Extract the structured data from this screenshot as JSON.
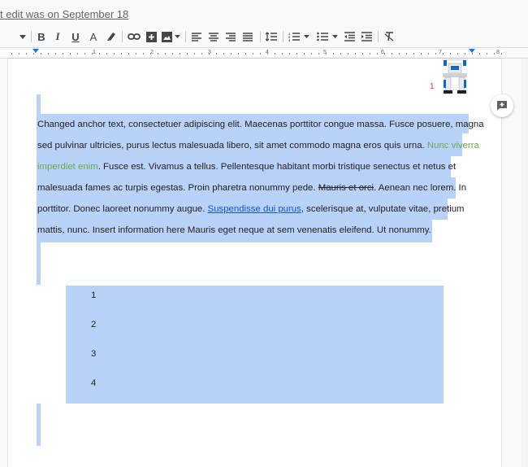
{
  "header": {
    "last_edit": "t edit was on September 18"
  },
  "toolbar": {
    "bold": "B",
    "italic": "I",
    "underline": "U",
    "text_color": "A"
  },
  "ruler": {
    "numbers": [
      "1",
      "2",
      "3",
      "4",
      "5",
      "6",
      "7",
      "8"
    ]
  },
  "document": {
    "lines": [
      [
        {
          "text": "Changed anchor text, consectetuer adipiscing elit. Maecenas porttitor congue massa. Fusce posuere, magna",
          "style": "normal"
        }
      ],
      [
        {
          "text": "sed pulvinar ultricies, purus lectus malesuada libero, sit amet commodo magna eros quis urna. ",
          "style": "normal"
        },
        {
          "text": "Nunc viverra",
          "style": "green"
        }
      ],
      [
        {
          "text": "imperdiet enim",
          "style": "green"
        },
        {
          "text": ". Fusce est. Vivamus a tellus. Pellentesque habitant morbi tristique senectus et netus et",
          "style": "normal"
        }
      ],
      [
        {
          "text": "malesuada fames ac turpis egestas. Proin pharetra nonummy pede. ",
          "style": "normal"
        },
        {
          "text": "Mauris et orci",
          "style": "strike"
        },
        {
          "text": ". Aenean nec lorem. In",
          "style": "normal"
        }
      ],
      [
        {
          "text": "porttitor. Donec laoreet nonummy augue. ",
          "style": "normal"
        },
        {
          "text": "Suspendisse dui purus",
          "style": "link"
        },
        {
          "text": ", scelerisque at, vulputate vitae, pretium",
          "style": "normal"
        }
      ],
      [
        {
          "text": "mattis, nunc. Insert information here Mauris eget neque at sem venenatis eleifend. Ut nonummy.",
          "style": "normal"
        }
      ]
    ],
    "footnote_marker": "1",
    "table_rows": [
      "1",
      "2",
      "3",
      "4"
    ]
  },
  "colors": {
    "selection": "#b8d2fa",
    "link": "#1155cc",
    "green_text": "#6aa84f",
    "footnote": "#d93025"
  }
}
